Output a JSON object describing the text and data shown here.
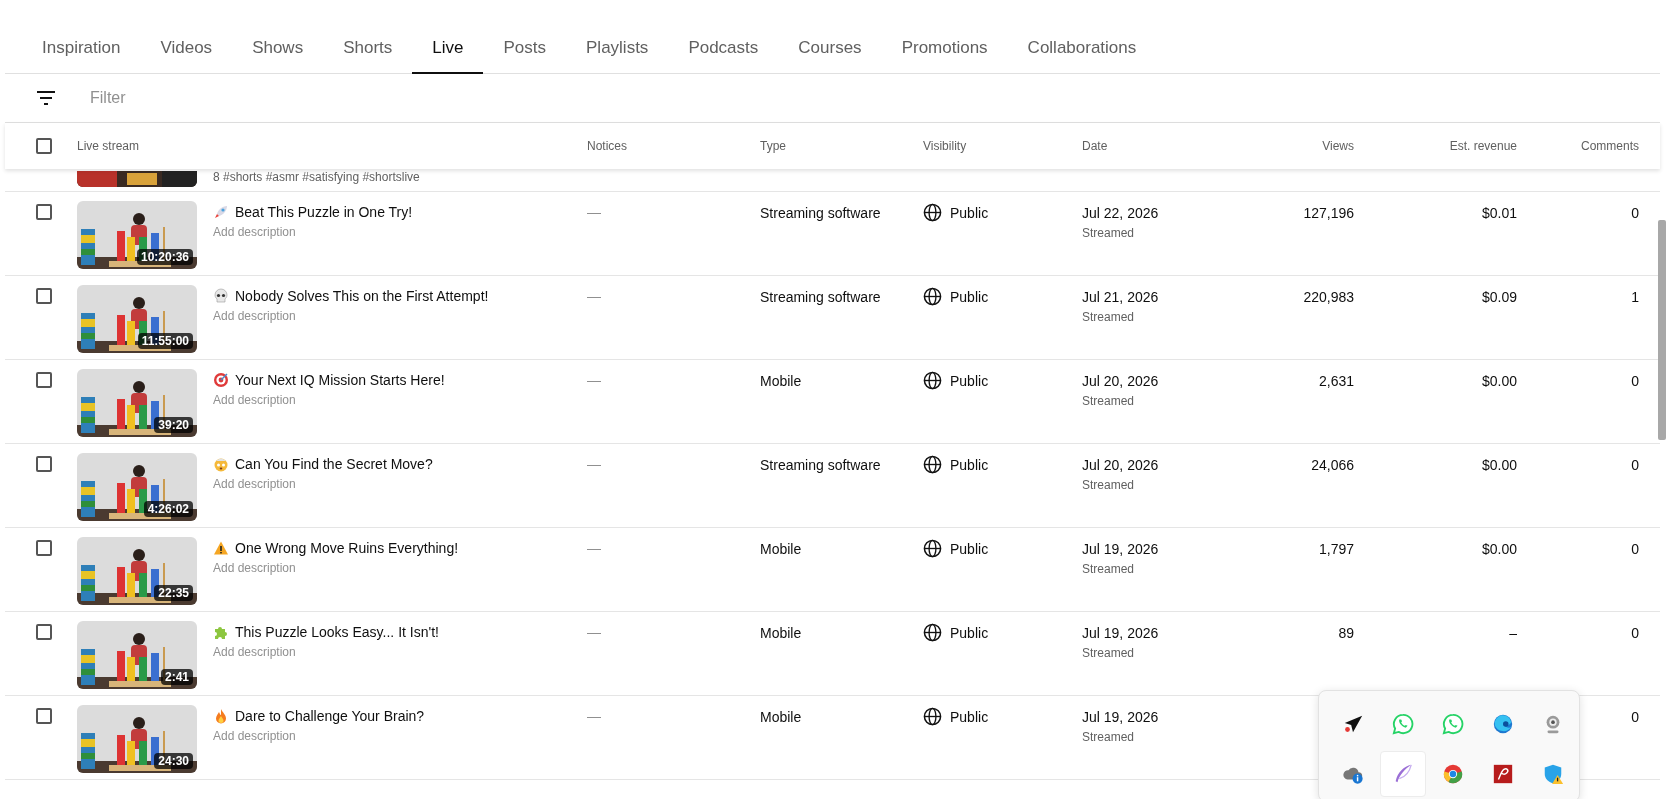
{
  "tabs": [
    {
      "label": "Inspiration",
      "selected": false
    },
    {
      "label": "Videos",
      "selected": false
    },
    {
      "label": "Shows",
      "selected": false
    },
    {
      "label": "Shorts",
      "selected": false
    },
    {
      "label": "Live",
      "selected": true
    },
    {
      "label": "Posts",
      "selected": false
    },
    {
      "label": "Playlists",
      "selected": false
    },
    {
      "label": "Podcasts",
      "selected": false
    },
    {
      "label": "Courses",
      "selected": false
    },
    {
      "label": "Promotions",
      "selected": false
    },
    {
      "label": "Collaborations",
      "selected": false
    }
  ],
  "filter": {
    "placeholder": "Filter"
  },
  "table": {
    "select_all": {
      "checked": false
    },
    "columns": [
      "Live stream",
      "Notices",
      "Type",
      "Visibility",
      "Date",
      "Views",
      "Est. revenue",
      "Comments"
    ],
    "partial_row": {
      "description": "8 #shorts #asmr #satisfying #shortslive"
    },
    "rows": [
      {
        "checked": false,
        "kind": "rocket",
        "title": "Beat This Puzzle in One Try!",
        "description": "Add description",
        "thumbnail": {
          "kind": "picture",
          "duration": "10:20:36"
        },
        "notices": "—",
        "type": "Streaming software",
        "visibility": "Public",
        "date": "Jul 22, 2026",
        "date_note": "Streamed",
        "views": "127,196",
        "revenue": "$0.01",
        "comments": "0"
      },
      {
        "checked": false,
        "kind": "skull",
        "title": "Nobody Solves This on the First Attempt!",
        "description": "Add description",
        "thumbnail": {
          "kind": "picture",
          "duration": "11:55:00"
        },
        "notices": "—",
        "type": "Streaming software",
        "visibility": "Public",
        "date": "Jul 21, 2026",
        "date_note": "Streamed",
        "views": "220,983",
        "revenue": "$0.09",
        "comments": "1"
      },
      {
        "checked": false,
        "kind": "target",
        "title": "Your Next IQ Mission Starts Here!",
        "description": "Add description",
        "thumbnail": {
          "kind": "picture",
          "duration": "39:20"
        },
        "notices": "—",
        "type": "Mobile",
        "visibility": "Public",
        "date": "Jul 20, 2026",
        "date_note": "Streamed",
        "views": "2,631",
        "revenue": "$0.00",
        "comments": "0"
      },
      {
        "checked": false,
        "kind": "face",
        "title": "Can You Find the Secret Move?",
        "description": "Add description",
        "thumbnail": {
          "kind": "picture",
          "duration": "4:26:02"
        },
        "notices": "—",
        "type": "Streaming software",
        "visibility": "Public",
        "date": "Jul 20, 2026",
        "date_note": "Streamed",
        "views": "24,066",
        "revenue": "$0.00",
        "comments": "0"
      },
      {
        "checked": false,
        "kind": "warning",
        "title": "One Wrong Move Ruins Everything!",
        "description": "Add description",
        "thumbnail": {
          "kind": "picture",
          "duration": "22:35"
        },
        "notices": "—",
        "type": "Mobile",
        "visibility": "Public",
        "date": "Jul 19, 2026",
        "date_note": "Streamed",
        "views": "1,797",
        "revenue": "$0.00",
        "comments": "0"
      },
      {
        "checked": false,
        "kind": "puzzle",
        "title": "This Puzzle Looks Easy... It Isn't!",
        "description": "Add description",
        "thumbnail": {
          "kind": "picture",
          "duration": "2:41"
        },
        "notices": "—",
        "type": "Mobile",
        "visibility": "Public",
        "date": "Jul 19, 2026",
        "date_note": "Streamed",
        "views": "89",
        "revenue": "–",
        "comments": "0"
      },
      {
        "checked": false,
        "kind": "fire",
        "title": "Dare to Challenge Your Brain?",
        "description": "Add description",
        "thumbnail": {
          "kind": "picture",
          "duration": "24:30"
        },
        "notices": "—",
        "type": "Mobile",
        "visibility": "Public",
        "date": "Jul 19, 2026",
        "date_note": "Streamed",
        "comments": "0"
      }
    ]
  },
  "tray": {
    "icons": [
      {
        "kind": "send",
        "selected": false
      },
      {
        "kind": "chat",
        "selected": false
      },
      {
        "kind": "chat",
        "selected": false
      },
      {
        "kind": "swirl",
        "selected": false
      },
      {
        "kind": "webcam",
        "selected": false
      },
      {
        "kind": "cloud",
        "selected": false
      },
      {
        "kind": "feather",
        "selected": true
      },
      {
        "kind": "ring",
        "selected": false
      },
      {
        "kind": "redsquare",
        "selected": false
      },
      {
        "kind": "shield",
        "selected": false
      }
    ]
  }
}
